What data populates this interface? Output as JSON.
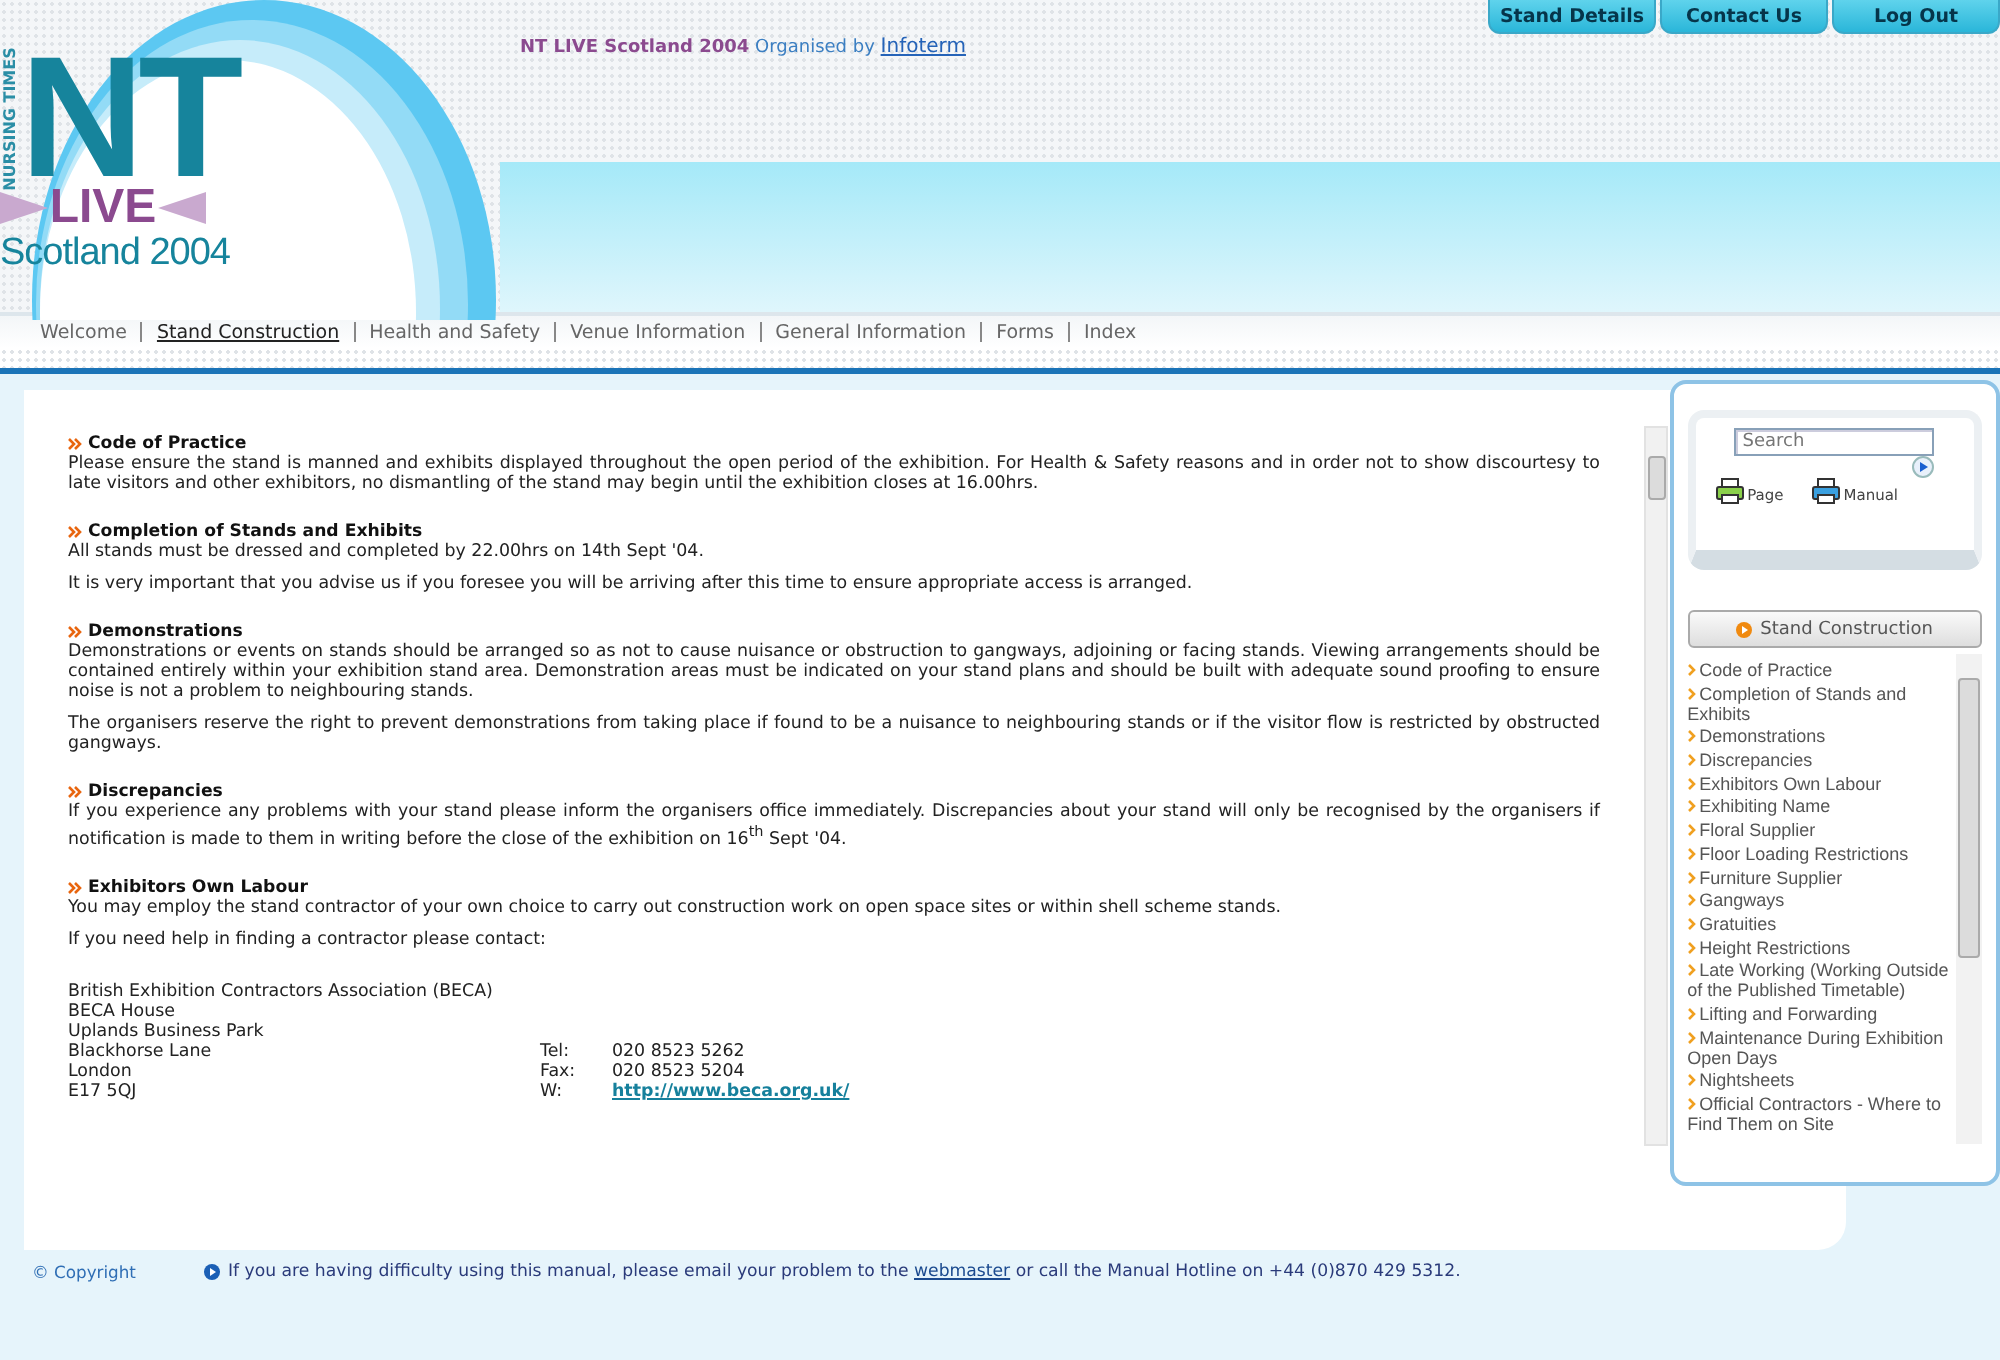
{
  "logo": {
    "vertical": "NURSING TIMES",
    "letters": "NT",
    "live": "LIVE",
    "place": "Scotland 2004"
  },
  "tagline": {
    "event": "NT LIVE Scotland 2004",
    "organised": "Organised by",
    "link": "Infoterm"
  },
  "top_tabs": [
    "Stand Details",
    "Contact Us",
    "Log Out"
  ],
  "nav": [
    {
      "label": "Welcome",
      "selected": false
    },
    {
      "label": "Stand Construction",
      "selected": true
    },
    {
      "label": "Health and Safety",
      "selected": false
    },
    {
      "label": "Venue Information",
      "selected": false
    },
    {
      "label": "General Information",
      "selected": false
    },
    {
      "label": "Forms",
      "selected": false
    },
    {
      "label": "Index",
      "selected": false
    }
  ],
  "sections": [
    {
      "heading": "Code of Practice",
      "paragraphs": [
        "Please ensure the stand is manned and exhibits displayed throughout the open period of the exhibition. For Health & Safety reasons and in order not to show discourtesy to late visitors and other exhibitors, no dismantling of the stand may begin until the exhibition closes at 16.00hrs."
      ]
    },
    {
      "heading": "Completion of Stands and Exhibits",
      "paragraphs": [
        "All stands must be dressed and completed by 22.00hrs on 14th Sept '04.",
        "It is very important that you advise us if you foresee you will be arriving after this time to ensure appropriate access is arranged."
      ]
    },
    {
      "heading": "Demonstrations",
      "paragraphs": [
        "Demonstrations or events on stands should be arranged so as not to cause nuisance or obstruction to gangways, adjoining or facing stands. Viewing arrangements should be contained entirely within your exhibition stand area. Demonstration areas must be indicated on your stand plans and should be built with adequate sound proofing to ensure noise is not a problem to neighbouring stands.",
        "The organisers reserve the right to prevent demonstrations from taking place if found to be a nuisance to neighbouring stands or if the visitor flow is restricted by obstructed gangways."
      ]
    },
    {
      "heading": "Discrepancies",
      "paragraphs": [
        "If you experience any problems with your stand please inform the organisers office immediately. Discrepancies about your stand will only be recognised by the organisers if notification is made to them in writing before the close of the exhibition on 16$^{th}$ Sept '04."
      ]
    },
    {
      "heading": "Exhibitors Own Labour",
      "paragraphs": [
        "You may employ the stand contractor of your own choice to carry out construction work on open space sites or within shell scheme stands.",
        "If you need help in finding a contractor please contact:"
      ]
    }
  ],
  "contact": {
    "address": [
      "British Exhibition Contractors Association (BECA)",
      "BECA House",
      "Uplands Business Park",
      "Blackhorse Lane",
      "London",
      "E17 5QJ"
    ],
    "details": [
      {
        "label": "Tel:",
        "value": "020 8523 5262",
        "kind": "text"
      },
      {
        "label": "Fax:",
        "value": "020 8523 5204",
        "kind": "text"
      },
      {
        "label": "W:",
        "value": "http://www.beca.org.uk/",
        "kind": "link"
      }
    ]
  },
  "sidebar": {
    "search": {
      "placeholder": "Search"
    },
    "print": [
      "Page",
      "Manual"
    ],
    "section_button": "Stand Construction",
    "items": [
      "Code of Practice",
      "Completion of Stands and Exhibits",
      "Demonstrations",
      "Discrepancies",
      "Exhibitors Own Labour",
      "Exhibiting Name",
      "Floral Supplier",
      "Floor Loading Restrictions",
      "Furniture Supplier",
      "Gangways",
      "Gratuities",
      "Height Restrictions",
      "Late Working (Working Outside of the Published Timetable)",
      "Lifting and Forwarding",
      "Maintenance During Exhibition Open Days",
      "Nightsheets",
      "Official Contractors - Where to Find Them on Site"
    ]
  },
  "footer": {
    "copyright": "© Copyright",
    "notice_before": "If you are having difficulty using this manual, please email your problem to the",
    "link": "webmaster",
    "notice_after": "or call the Manual Hotline on +44 (0)870 429 5312."
  }
}
